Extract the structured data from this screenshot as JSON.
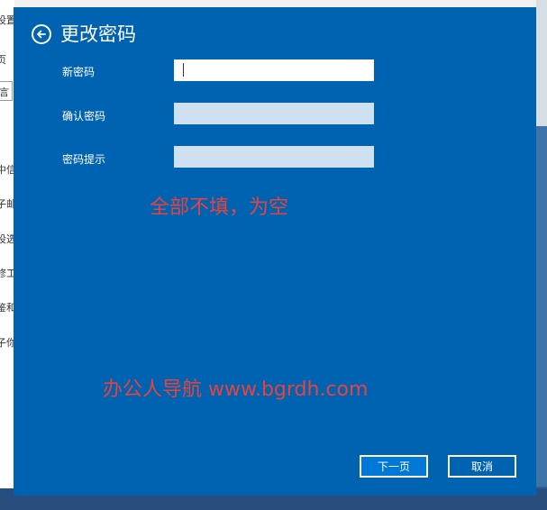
{
  "background_window": {
    "side_texts": [
      "设置",
      "页",
      "中信",
      "子邮",
      "设选",
      "修工",
      "鉴和",
      "子你"
    ],
    "search_fragment": "言"
  },
  "dialog": {
    "title": "更改密码",
    "back_icon": "back-arrow-icon",
    "fields": [
      {
        "label": "新密码",
        "value": "",
        "focused": true
      },
      {
        "label": "确认密码",
        "value": "",
        "focused": false
      },
      {
        "label": "密码提示",
        "value": "",
        "focused": false
      }
    ],
    "note": "全部不填，为空",
    "watermark": "办公人导航 www.bgrdh.com",
    "buttons": {
      "next": "下一页",
      "cancel": "取消"
    },
    "colors": {
      "background": "#0063b1",
      "note": "#e8423e",
      "input_empty": "#cfe0f0"
    }
  }
}
